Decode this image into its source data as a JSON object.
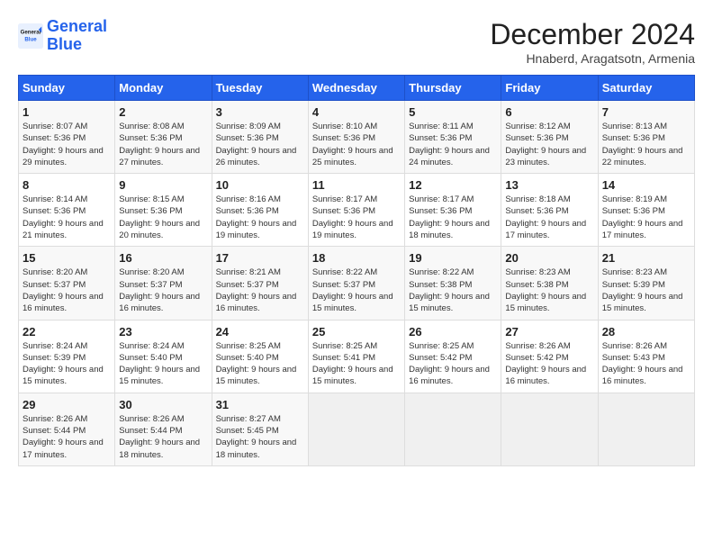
{
  "logo": {
    "text_general": "General",
    "text_blue": "Blue"
  },
  "title": "December 2024",
  "subtitle": "Hnaberd, Aragatsotn, Armenia",
  "days_of_week": [
    "Sunday",
    "Monday",
    "Tuesday",
    "Wednesday",
    "Thursday",
    "Friday",
    "Saturday"
  ],
  "weeks": [
    [
      {
        "day": "1",
        "sunrise": "8:07 AM",
        "sunset": "5:36 PM",
        "daylight": "9 hours and 29 minutes."
      },
      {
        "day": "2",
        "sunrise": "8:08 AM",
        "sunset": "5:36 PM",
        "daylight": "9 hours and 27 minutes."
      },
      {
        "day": "3",
        "sunrise": "8:09 AM",
        "sunset": "5:36 PM",
        "daylight": "9 hours and 26 minutes."
      },
      {
        "day": "4",
        "sunrise": "8:10 AM",
        "sunset": "5:36 PM",
        "daylight": "9 hours and 25 minutes."
      },
      {
        "day": "5",
        "sunrise": "8:11 AM",
        "sunset": "5:36 PM",
        "daylight": "9 hours and 24 minutes."
      },
      {
        "day": "6",
        "sunrise": "8:12 AM",
        "sunset": "5:36 PM",
        "daylight": "9 hours and 23 minutes."
      },
      {
        "day": "7",
        "sunrise": "8:13 AM",
        "sunset": "5:36 PM",
        "daylight": "9 hours and 22 minutes."
      }
    ],
    [
      {
        "day": "8",
        "sunrise": "8:14 AM",
        "sunset": "5:36 PM",
        "daylight": "9 hours and 21 minutes."
      },
      {
        "day": "9",
        "sunrise": "8:15 AM",
        "sunset": "5:36 PM",
        "daylight": "9 hours and 20 minutes."
      },
      {
        "day": "10",
        "sunrise": "8:16 AM",
        "sunset": "5:36 PM",
        "daylight": "9 hours and 19 minutes."
      },
      {
        "day": "11",
        "sunrise": "8:17 AM",
        "sunset": "5:36 PM",
        "daylight": "9 hours and 19 minutes."
      },
      {
        "day": "12",
        "sunrise": "8:17 AM",
        "sunset": "5:36 PM",
        "daylight": "9 hours and 18 minutes."
      },
      {
        "day": "13",
        "sunrise": "8:18 AM",
        "sunset": "5:36 PM",
        "daylight": "9 hours and 17 minutes."
      },
      {
        "day": "14",
        "sunrise": "8:19 AM",
        "sunset": "5:36 PM",
        "daylight": "9 hours and 17 minutes."
      }
    ],
    [
      {
        "day": "15",
        "sunrise": "8:20 AM",
        "sunset": "5:37 PM",
        "daylight": "9 hours and 16 minutes."
      },
      {
        "day": "16",
        "sunrise": "8:20 AM",
        "sunset": "5:37 PM",
        "daylight": "9 hours and 16 minutes."
      },
      {
        "day": "17",
        "sunrise": "8:21 AM",
        "sunset": "5:37 PM",
        "daylight": "9 hours and 16 minutes."
      },
      {
        "day": "18",
        "sunrise": "8:22 AM",
        "sunset": "5:37 PM",
        "daylight": "9 hours and 15 minutes."
      },
      {
        "day": "19",
        "sunrise": "8:22 AM",
        "sunset": "5:38 PM",
        "daylight": "9 hours and 15 minutes."
      },
      {
        "day": "20",
        "sunrise": "8:23 AM",
        "sunset": "5:38 PM",
        "daylight": "9 hours and 15 minutes."
      },
      {
        "day": "21",
        "sunrise": "8:23 AM",
        "sunset": "5:39 PM",
        "daylight": "9 hours and 15 minutes."
      }
    ],
    [
      {
        "day": "22",
        "sunrise": "8:24 AM",
        "sunset": "5:39 PM",
        "daylight": "9 hours and 15 minutes."
      },
      {
        "day": "23",
        "sunrise": "8:24 AM",
        "sunset": "5:40 PM",
        "daylight": "9 hours and 15 minutes."
      },
      {
        "day": "24",
        "sunrise": "8:25 AM",
        "sunset": "5:40 PM",
        "daylight": "9 hours and 15 minutes."
      },
      {
        "day": "25",
        "sunrise": "8:25 AM",
        "sunset": "5:41 PM",
        "daylight": "9 hours and 15 minutes."
      },
      {
        "day": "26",
        "sunrise": "8:25 AM",
        "sunset": "5:42 PM",
        "daylight": "9 hours and 16 minutes."
      },
      {
        "day": "27",
        "sunrise": "8:26 AM",
        "sunset": "5:42 PM",
        "daylight": "9 hours and 16 minutes."
      },
      {
        "day": "28",
        "sunrise": "8:26 AM",
        "sunset": "5:43 PM",
        "daylight": "9 hours and 16 minutes."
      }
    ],
    [
      {
        "day": "29",
        "sunrise": "8:26 AM",
        "sunset": "5:44 PM",
        "daylight": "9 hours and 17 minutes."
      },
      {
        "day": "30",
        "sunrise": "8:26 AM",
        "sunset": "5:44 PM",
        "daylight": "9 hours and 18 minutes."
      },
      {
        "day": "31",
        "sunrise": "8:27 AM",
        "sunset": "5:45 PM",
        "daylight": "9 hours and 18 minutes."
      },
      null,
      null,
      null,
      null
    ]
  ]
}
